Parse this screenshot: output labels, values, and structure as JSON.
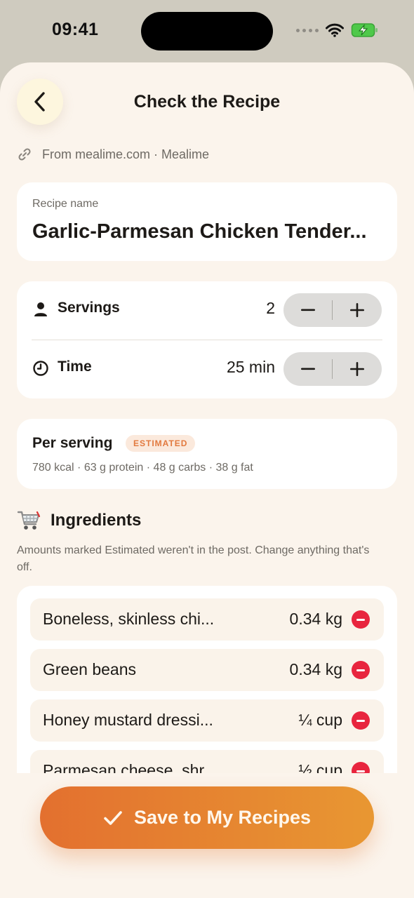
{
  "status_bar": {
    "time": "09:41"
  },
  "header": {
    "title": "Check the Recipe"
  },
  "source": {
    "text": "From mealime.com · Mealime"
  },
  "recipe_name": {
    "label": "Recipe name",
    "value": "Garlic-Parmesan Chicken Tender..."
  },
  "servings": {
    "label": "Servings",
    "value": "2"
  },
  "time": {
    "label": "Time",
    "value": "25 min"
  },
  "per_serving": {
    "title": "Per serving",
    "badge": "ESTIMATED",
    "stats": "780 kcal · 63 g protein · 48 g carbs · 38 g fat"
  },
  "ingredients": {
    "title": "Ingredients",
    "note": "Amounts marked Estimated weren't in the post. Change anything that's off.",
    "items": [
      {
        "name": "Boneless, skinless chi...",
        "amount": "0.34 kg"
      },
      {
        "name": "Green beans",
        "amount": "0.34 kg"
      },
      {
        "name": "Honey mustard dressi...",
        "amount": "¼ cup"
      },
      {
        "name": "Parmesan cheese, shr...",
        "amount": "½ cup"
      }
    ]
  },
  "save_button": {
    "label": "Save to My Recipes"
  },
  "colors": {
    "accent_start": "#e3702f",
    "accent_end": "#e89732",
    "remove": "#e8253e",
    "badge_text": "#e2793e"
  }
}
